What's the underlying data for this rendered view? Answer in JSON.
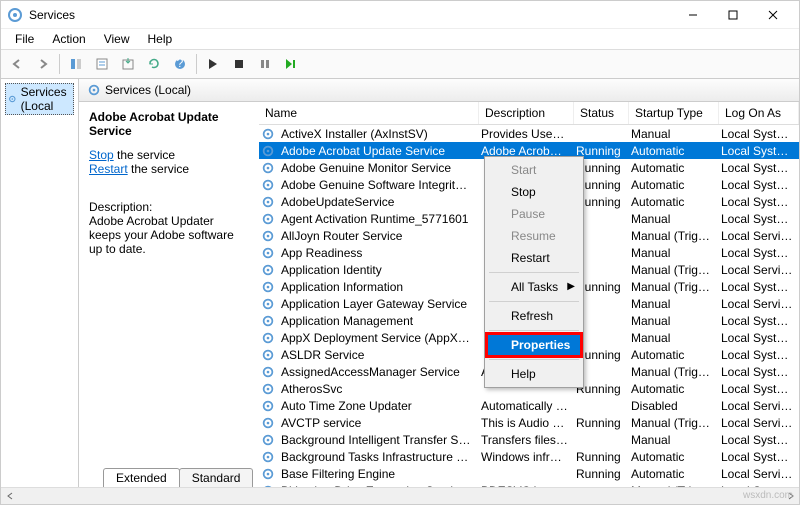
{
  "window": {
    "title": "Services"
  },
  "menubar": [
    "File",
    "Action",
    "View",
    "Help"
  ],
  "left_pane": {
    "node": "Services (Local"
  },
  "right_header": {
    "label": "Services (Local)"
  },
  "task_pane": {
    "service_name": "Adobe Acrobat Update Service",
    "action_stop": "Stop",
    "action_stop_suffix": " the service",
    "action_restart": "Restart",
    "action_restart_suffix": " the service",
    "desc_label": "Description:",
    "desc_text": "Adobe Acrobat Updater keeps your Adobe software up to date."
  },
  "columns": {
    "name": "Name",
    "description": "Description",
    "status": "Status",
    "startup": "Startup Type",
    "logon": "Log On As"
  },
  "rows": [
    {
      "name": "ActiveX Installer (AxInstSV)",
      "desc": "Provides User A...",
      "status": "",
      "startup": "Manual",
      "logon": "Local System",
      "sel": false
    },
    {
      "name": "Adobe Acrobat Update Service",
      "desc": "Adobe Acrobat ...",
      "status": "Running",
      "startup": "Automatic",
      "logon": "Local System",
      "sel": true
    },
    {
      "name": "Adobe Genuine Monitor Service",
      "desc": "",
      "status": "Running",
      "startup": "Automatic",
      "logon": "Local System",
      "sel": false
    },
    {
      "name": "Adobe Genuine Software Integrity Se",
      "desc": "",
      "status": "Running",
      "startup": "Automatic",
      "logon": "Local System",
      "sel": false
    },
    {
      "name": "AdobeUpdateService",
      "desc": "",
      "status": "Running",
      "startup": "Automatic",
      "logon": "Local System",
      "sel": false
    },
    {
      "name": "Agent Activation Runtime_5771601",
      "desc": "",
      "status": "",
      "startup": "Manual",
      "logon": "Local System",
      "sel": false
    },
    {
      "name": "AllJoyn Router Service",
      "desc": "",
      "status": "",
      "startup": "Manual (Trigg...",
      "logon": "Local Service",
      "sel": false
    },
    {
      "name": "App Readiness",
      "desc": "",
      "status": "",
      "startup": "Manual",
      "logon": "Local System",
      "sel": false
    },
    {
      "name": "Application Identity",
      "desc": "",
      "status": "",
      "startup": "Manual (Trigg...",
      "logon": "Local Service",
      "sel": false
    },
    {
      "name": "Application Information",
      "desc": "",
      "status": "Running",
      "startup": "Manual (Trigg...",
      "logon": "Local System",
      "sel": false
    },
    {
      "name": "Application Layer Gateway Service",
      "desc": "",
      "status": "",
      "startup": "Manual",
      "logon": "Local Service",
      "sel": false
    },
    {
      "name": "Application Management",
      "desc": "",
      "status": "",
      "startup": "Manual",
      "logon": "Local System",
      "sel": false
    },
    {
      "name": "AppX Deployment Service (AppXSVC",
      "desc": "",
      "status": "",
      "startup": "Manual",
      "logon": "Local System",
      "sel": false
    },
    {
      "name": "ASLDR Service",
      "desc": "",
      "status": "Running",
      "startup": "Automatic",
      "logon": "Local System",
      "sel": false
    },
    {
      "name": "AssignedAccessManager Service",
      "desc": "AssignedAccess...",
      "status": "",
      "startup": "Manual (Trigg...",
      "logon": "Local System",
      "sel": false
    },
    {
      "name": "AtherosSvc",
      "desc": "",
      "status": "Running",
      "startup": "Automatic",
      "logon": "Local System",
      "sel": false
    },
    {
      "name": "Auto Time Zone Updater",
      "desc": "Automatically s...",
      "status": "",
      "startup": "Disabled",
      "logon": "Local Service",
      "sel": false
    },
    {
      "name": "AVCTP service",
      "desc": "This is Audio Vi...",
      "status": "Running",
      "startup": "Manual (Trigg...",
      "logon": "Local Service",
      "sel": false
    },
    {
      "name": "Background Intelligent Transfer Service",
      "desc": "Transfers files i...",
      "status": "",
      "startup": "Manual",
      "logon": "Local System",
      "sel": false
    },
    {
      "name": "Background Tasks Infrastructure Service",
      "desc": "Windows infras...",
      "status": "Running",
      "startup": "Automatic",
      "logon": "Local System",
      "sel": false
    },
    {
      "name": "Base Filtering Engine",
      "desc": "",
      "status": "Running",
      "startup": "Automatic",
      "logon": "Local Service",
      "sel": false
    },
    {
      "name": "BitLocker Drive Encryption Service",
      "desc": "BDESVC hosts t...",
      "status": "",
      "startup": "Manual (Trigg...",
      "logon": "Local System",
      "sel": false
    }
  ],
  "context_menu": {
    "start": "Start",
    "stop": "Stop",
    "pause": "Pause",
    "resume": "Resume",
    "restart": "Restart",
    "all_tasks": "All Tasks",
    "refresh": "Refresh",
    "properties": "Properties",
    "help": "Help"
  },
  "tabs": {
    "extended": "Extended",
    "standard": "Standard"
  },
  "watermark": "wsxdn.com"
}
